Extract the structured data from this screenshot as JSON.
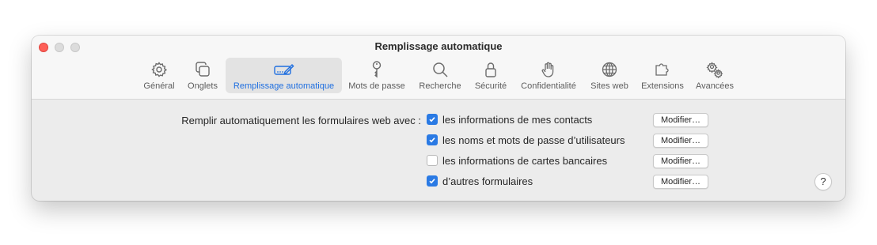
{
  "window": {
    "title": "Remplissage automatique"
  },
  "toolbar": {
    "tabs": [
      {
        "label": "Général",
        "icon": "gear-icon",
        "selected": false
      },
      {
        "label": "Onglets",
        "icon": "tabs-icon",
        "selected": false
      },
      {
        "label": "Remplissage automatique",
        "icon": "autofill-icon",
        "selected": true
      },
      {
        "label": "Mots de passe",
        "icon": "key-icon",
        "selected": false
      },
      {
        "label": "Recherche",
        "icon": "magnifier-icon",
        "selected": false
      },
      {
        "label": "Sécurité",
        "icon": "lock-icon",
        "selected": false
      },
      {
        "label": "Confidentialité",
        "icon": "hand-icon",
        "selected": false
      },
      {
        "label": "Sites web",
        "icon": "globe-icon",
        "selected": false
      },
      {
        "label": "Extensions",
        "icon": "puzzle-icon",
        "selected": false
      },
      {
        "label": "Avancées",
        "icon": "gears-icon",
        "selected": false
      }
    ]
  },
  "autofill": {
    "label": "Remplir automatiquement les formulaires web avec :",
    "options": [
      {
        "label": "les informations de mes contacts",
        "checked": true,
        "button": "Modifier…"
      },
      {
        "label": "les noms et mots de passe d’utilisateurs",
        "checked": true,
        "button": "Modifier…"
      },
      {
        "label": "les informations de cartes bancaires",
        "checked": false,
        "button": "Modifier…"
      },
      {
        "label": "d’autres formulaires",
        "checked": true,
        "button": "Modifier…"
      }
    ]
  },
  "help": {
    "label": "?"
  },
  "colors": {
    "accent": "#2a7ae4",
    "selected_label": "#1f6fe0",
    "close": "#fe5f57"
  }
}
